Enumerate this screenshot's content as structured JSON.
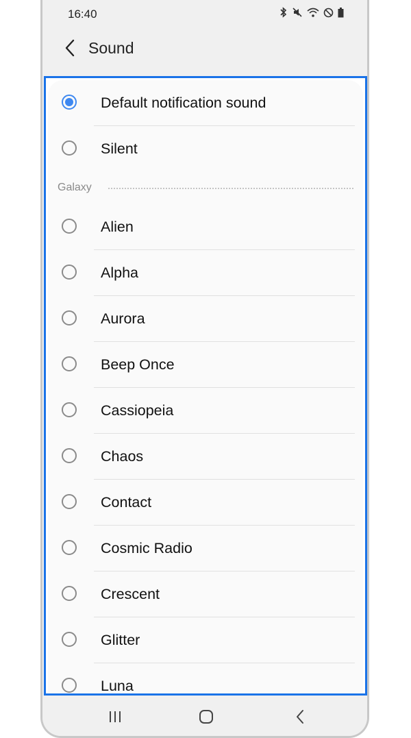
{
  "status_bar": {
    "time": "16:40",
    "icons": [
      "bluetooth-icon",
      "mute-icon",
      "wifi-icon",
      "do-not-disturb-icon",
      "battery-icon"
    ]
  },
  "app_bar": {
    "title": "Sound",
    "back_icon": "chevron-left-icon"
  },
  "sound_list": {
    "top_options": [
      {
        "label": "Default notification sound",
        "selected": true
      },
      {
        "label": "Silent",
        "selected": false
      }
    ],
    "section_header": "Galaxy",
    "galaxy_options": [
      {
        "label": "Alien",
        "selected": false
      },
      {
        "label": "Alpha",
        "selected": false
      },
      {
        "label": "Aurora",
        "selected": false
      },
      {
        "label": "Beep Once",
        "selected": false
      },
      {
        "label": "Cassiopeia",
        "selected": false
      },
      {
        "label": "Chaos",
        "selected": false
      },
      {
        "label": "Contact",
        "selected": false
      },
      {
        "label": "Cosmic Radio",
        "selected": false
      },
      {
        "label": "Crescent",
        "selected": false
      },
      {
        "label": "Glitter",
        "selected": false
      },
      {
        "label": "Luna",
        "selected": false
      }
    ]
  },
  "nav_bar": {
    "buttons": [
      "recent-apps-icon",
      "home-icon",
      "back-icon"
    ]
  },
  "colors": {
    "accent": "#3e88f0",
    "highlight_frame": "#1a73e8"
  }
}
